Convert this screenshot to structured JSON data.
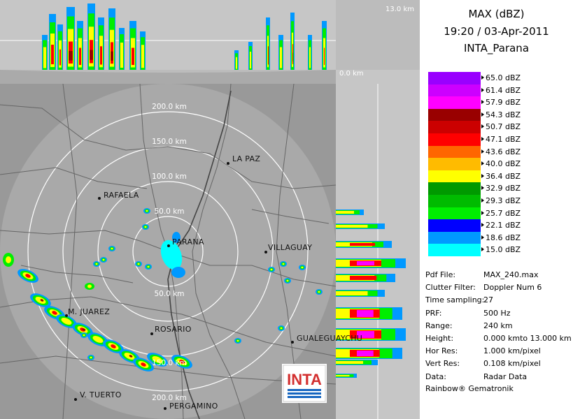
{
  "header": {
    "product": "MAX (dBZ)",
    "datetime": "19:20 / 03-Apr-2011",
    "station": "INTA_Parana"
  },
  "axes": {
    "top_max_height": "13.0 km",
    "side_zero_height": "0.0 km"
  },
  "range_rings": [
    "50.0 km",
    "100.0 km",
    "150.0 km",
    "200.0 km"
  ],
  "range_ring_labels": {
    "north_200": "200.0 km",
    "north_150": "150.0 km",
    "north_100": "100.0 km",
    "north_50": "50.0 km",
    "south_50": "50.0 km",
    "south_150": "150.0 km",
    "south_200": "200.0 km"
  },
  "cities": [
    {
      "name": "LA PAZ"
    },
    {
      "name": "RAFAELA"
    },
    {
      "name": "PARANA"
    },
    {
      "name": "VILLAGUAY"
    },
    {
      "name": "M. JUAREZ"
    },
    {
      "name": "ROSARIO"
    },
    {
      "name": "GUALEGUAYCHU"
    },
    {
      "name": "V. TUERTO"
    },
    {
      "name": "PERGAMINO"
    }
  ],
  "legend": [
    {
      "label": "65.0 dBZ",
      "color": "#9900ff"
    },
    {
      "label": "61.4 dBZ",
      "color": "#cc00ff"
    },
    {
      "label": "57.9 dBZ",
      "color": "#ff00ff"
    },
    {
      "label": "54.3 dBZ",
      "color": "#990000"
    },
    {
      "label": "50.7 dBZ",
      "color": "#cc0000"
    },
    {
      "label": "47.1 dBZ",
      "color": "#ff0000"
    },
    {
      "label": "43.6 dBZ",
      "color": "#ff6600"
    },
    {
      "label": "40.0 dBZ",
      "color": "#ffbb00"
    },
    {
      "label": "36.4 dBZ",
      "color": "#ffff00"
    },
    {
      "label": "32.9 dBZ",
      "color": "#009900"
    },
    {
      "label": "29.3 dBZ",
      "color": "#00bb00"
    },
    {
      "label": "25.7 dBZ",
      "color": "#00ee00"
    },
    {
      "label": "22.1 dBZ",
      "color": "#0000ff"
    },
    {
      "label": "18.6 dBZ",
      "color": "#0099ff"
    },
    {
      "label": "15.0 dBZ",
      "color": "#00ffff"
    }
  ],
  "info": [
    {
      "key": "Pdf File:",
      "value": "MAX_240.max"
    },
    {
      "key": "Clutter Filter:",
      "value": "Doppler Num 6"
    },
    {
      "key": "Time sampling:",
      "value": "27"
    },
    {
      "key": "PRF:",
      "value": "500 Hz"
    },
    {
      "key": "Range:",
      "value": "240 km"
    },
    {
      "key": "Height:",
      "value": "0.000 kmto 13.000 km"
    },
    {
      "key": "Hor Res:",
      "value": "1.000 km/pixel"
    },
    {
      "key": "Vert Res:",
      "value": "0.108 km/pixel"
    },
    {
      "key": "Data:",
      "value": "Radar Data"
    }
  ],
  "footer": "Rainbow® Gematronik",
  "logo": {
    "text": "INTA",
    "color": "#d32f2f",
    "stripe_color": "#1565c0"
  }
}
